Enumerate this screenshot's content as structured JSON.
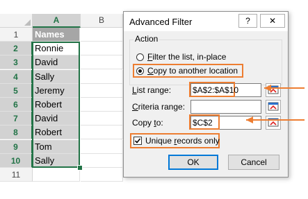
{
  "sheet": {
    "columns": [
      "A",
      "B"
    ],
    "rows": [
      {
        "num": "1",
        "value": "Names"
      },
      {
        "num": "2",
        "value": "Ronnie"
      },
      {
        "num": "3",
        "value": "David"
      },
      {
        "num": "4",
        "value": "Sally"
      },
      {
        "num": "5",
        "value": "Jeremy"
      },
      {
        "num": "6",
        "value": "Robert"
      },
      {
        "num": "7",
        "value": "David"
      },
      {
        "num": "8",
        "value": "Robert"
      },
      {
        "num": "9",
        "value": "Tom"
      },
      {
        "num": "10",
        "value": "Sally"
      },
      {
        "num": "11",
        "value": ""
      }
    ]
  },
  "dialog": {
    "title": "Advanced Filter",
    "help": "?",
    "close": "✕",
    "action_label": "Action",
    "radio_filter_prefix": "",
    "radio_filter_acc": "F",
    "radio_filter_rest": "ilter the list, in-place",
    "radio_copy_prefix": "",
    "radio_copy_acc": "C",
    "radio_copy_rest": "opy to another location",
    "list_range_label_prefix": "",
    "list_range_label_acc": "L",
    "list_range_label_rest": "ist range:",
    "list_range_value": "$A$2:$A$10",
    "criteria_label_prefix": "",
    "criteria_label_acc": "C",
    "criteria_label_rest": "riteria range:",
    "criteria_value": "",
    "copy_to_label_prefix": "Copy ",
    "copy_to_label_acc": "t",
    "copy_to_label_rest": "o:",
    "copy_to_value": "$C$2",
    "unique_prefix": "Unique ",
    "unique_acc": "r",
    "unique_rest": "ecords only",
    "unique_checked": true,
    "ok": "OK",
    "cancel": "Cancel"
  },
  "colors": {
    "excel_green": "#217346",
    "highlight_orange": "#ed7d31"
  }
}
